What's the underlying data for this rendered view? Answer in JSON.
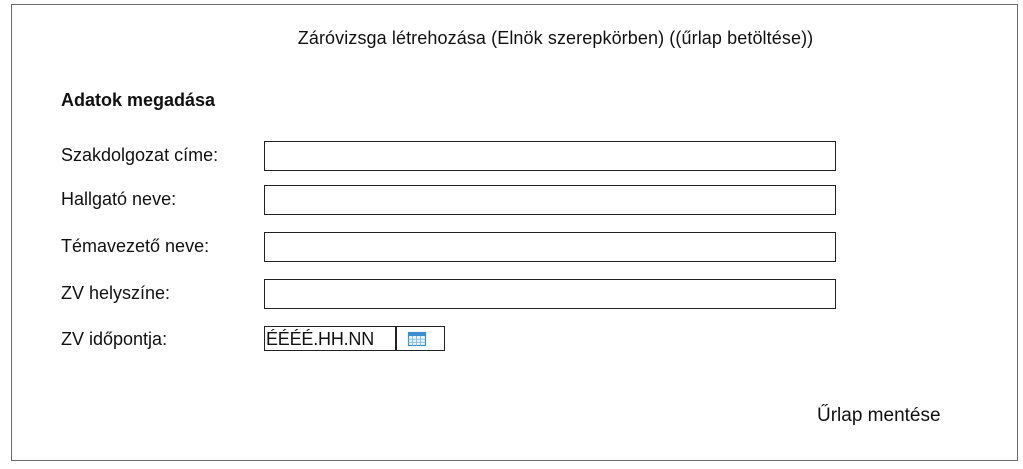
{
  "form": {
    "title": "Záróvizsga létrehozása (Elnök szerepkörben) ((űrlap betöltése))",
    "section_title": "Adatok megadása",
    "fields": [
      {
        "label": "Szakdolgozat címe:",
        "value": ""
      },
      {
        "label": "Hallgató neve:",
        "value": ""
      },
      {
        "label": "Témavezető neve:",
        "value": ""
      },
      {
        "label": "ZV helyszíne:",
        "value": ""
      },
      {
        "label": "ZV időpontja:",
        "placeholder": "ÉÉÉÉ.HH.NN",
        "icon": "calendar-icon"
      }
    ],
    "save_label": "Űrlap mentése"
  },
  "colors": {
    "border": "#222222",
    "frame": "#6b6b6b",
    "calendar_accent": "#3b8ed0"
  }
}
